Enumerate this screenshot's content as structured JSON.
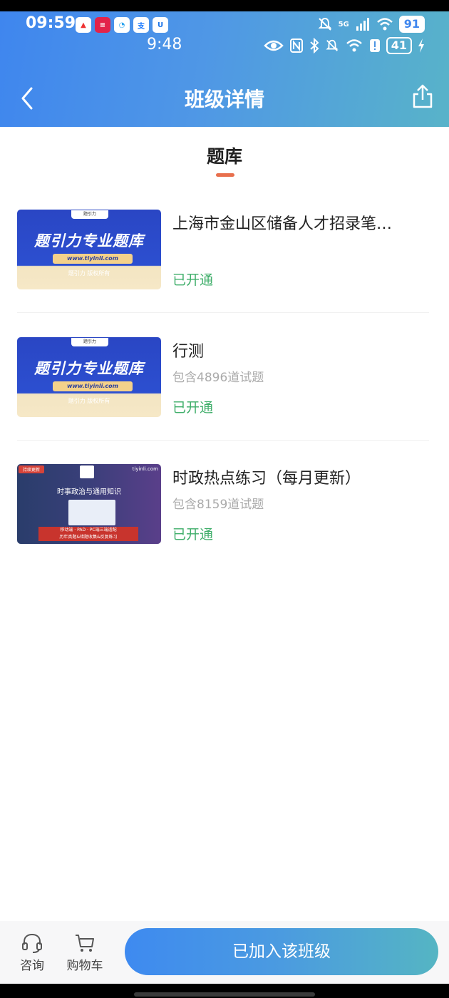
{
  "status_bar": {
    "time_primary": "09:59",
    "time_secondary": "9:48",
    "network_label": "5G",
    "battery_primary": "91",
    "battery_secondary": "41"
  },
  "header": {
    "title": "班级详情"
  },
  "tab": {
    "label": "题库"
  },
  "items": [
    {
      "title": "上海市金山区储备人才招录笔…",
      "subtitle": "",
      "status": "已开通",
      "thumbnail": {
        "headline": "题引力专业题库",
        "url": "www.tiyinli.com",
        "copyright": "题引力 版权所有",
        "brand": "题引力"
      }
    },
    {
      "title": "行测",
      "subtitle": "包含4896道试题",
      "status": "已开通",
      "thumbnail": {
        "headline": "题引力专业题库",
        "url": "www.tiyinli.com",
        "copyright": "题引力 版权所有",
        "brand": "题引力"
      }
    },
    {
      "title": "时政热点练习（每月更新）",
      "subtitle": "包含8159道试题",
      "status": "已开通",
      "thumbnail": {
        "tag": "持续更新",
        "site": "tiyinli.com",
        "subject": "时事政治与通用知识",
        "line1": "移动端 · PAD · PC端三端适配",
        "line2": "历年真题&错题收集&反复练习"
      }
    }
  ],
  "bottom_bar": {
    "consult_label": "咨询",
    "cart_label": "购物车",
    "join_label": "已加入该班级"
  },
  "colors": {
    "header_gradient_start": "#3f86ee",
    "header_gradient_end": "#58b3c9",
    "status_green": "#3fae6a",
    "tab_indicator": "#e86f4d"
  }
}
